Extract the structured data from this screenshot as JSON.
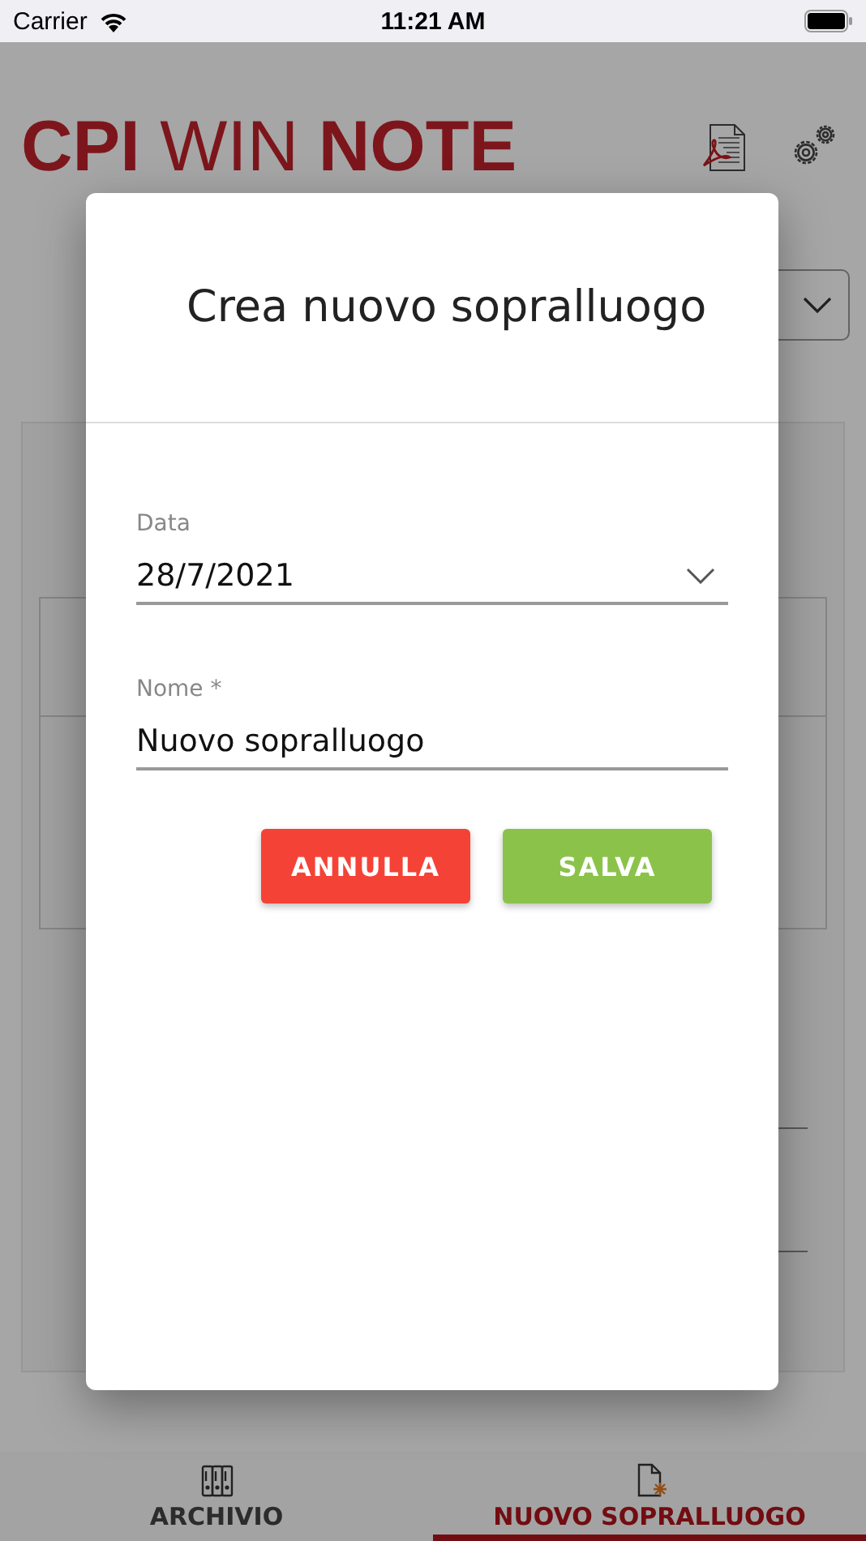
{
  "status_bar": {
    "carrier": "Carrier",
    "time": "11:21 AM"
  },
  "header": {
    "logo": "**CPI** WIN **NOTE**"
  },
  "dialog": {
    "title": "Crea nuovo sopralluogo",
    "fields": [
      {
        "kind": "select",
        "label": "Data",
        "value": "28/7/2021"
      },
      {
        "kind": "text",
        "label": "Nome *",
        "value": "Nuovo sopralluogo"
      }
    ],
    "buttons": [
      {
        "kind": "cancel",
        "label": "ANNULLA"
      },
      {
        "kind": "confirm",
        "label": "SALVA"
      }
    ]
  },
  "tabs": [
    {
      "kind": "archive",
      "label": "ARCHIVIO",
      "selected": false
    },
    {
      "kind": "new",
      "label": "NUOVO SOPRALLUOGO",
      "selected": true
    }
  ]
}
